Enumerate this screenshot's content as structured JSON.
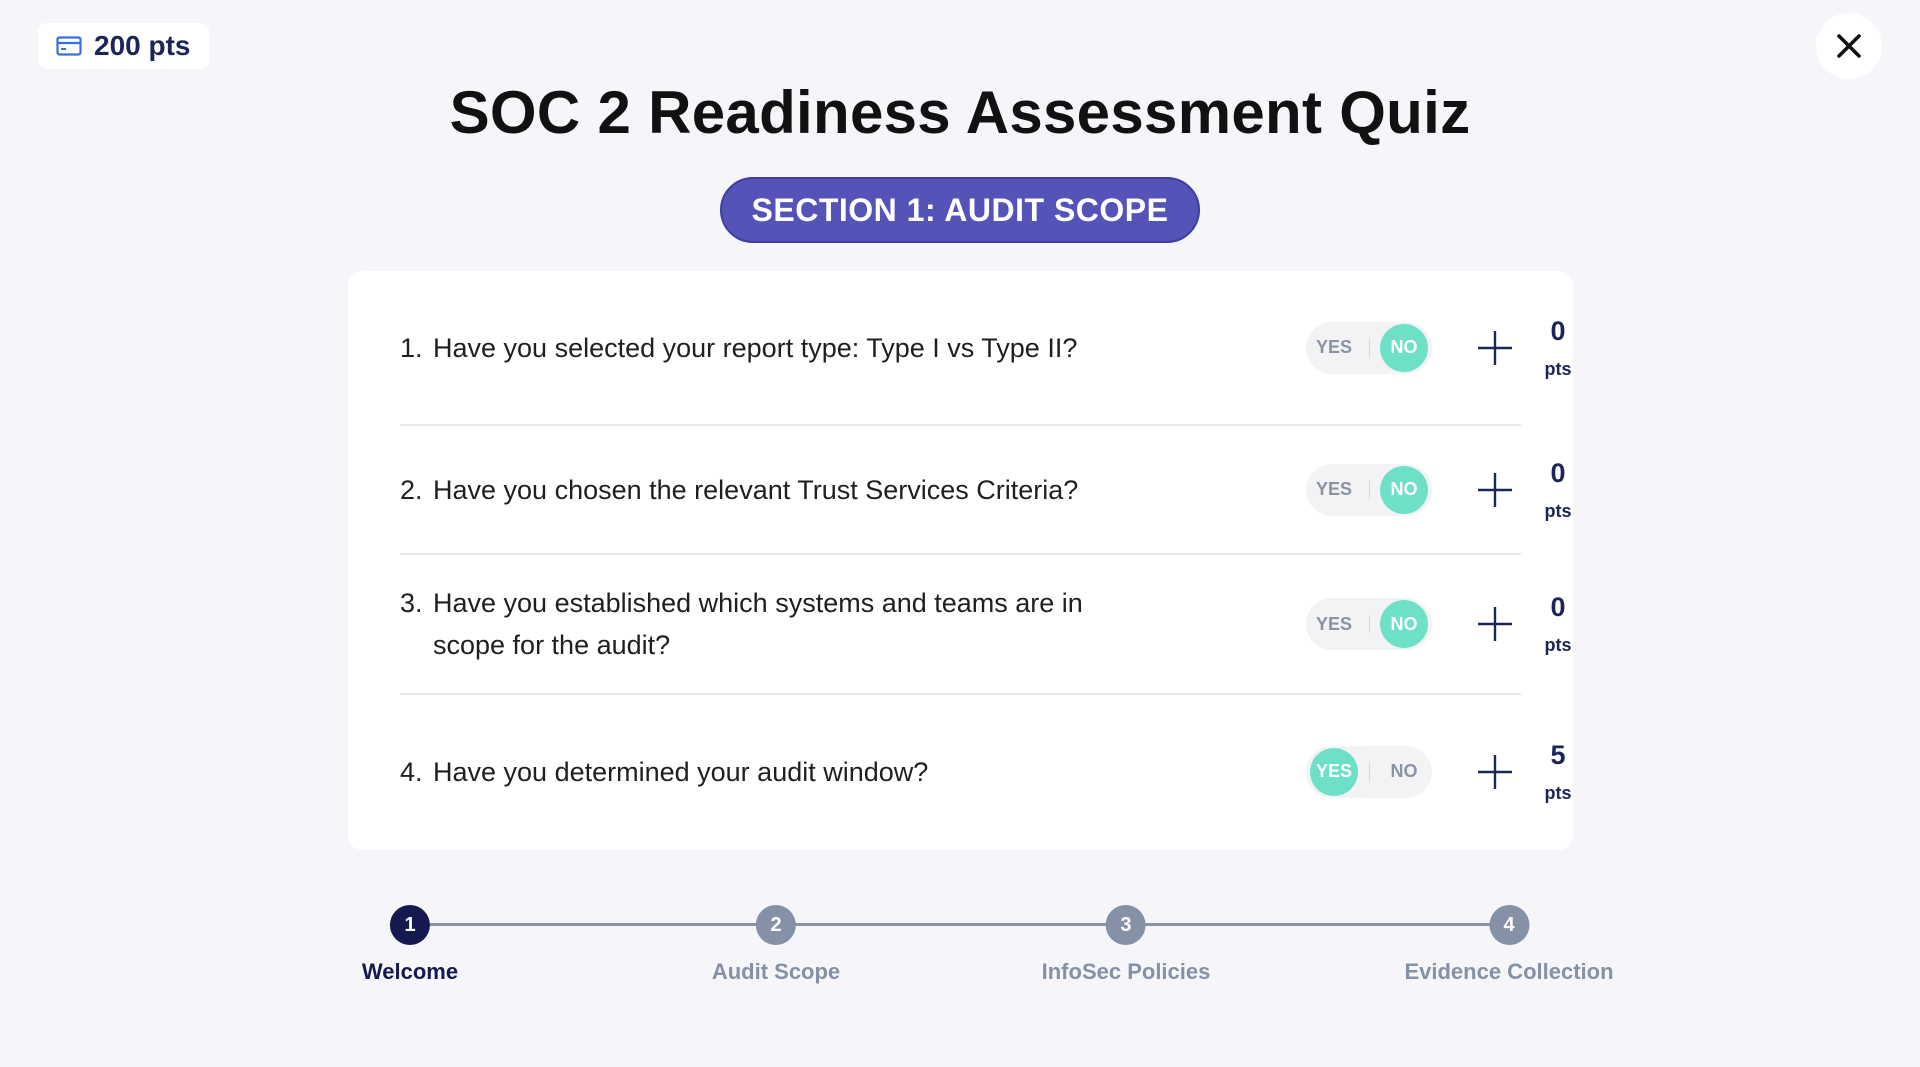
{
  "header": {
    "points_badge": "200 pts",
    "points_icon": "credit-card-icon",
    "close_icon": "close-icon"
  },
  "title": "SOC 2 Readiness Assessment Quiz",
  "section_label": "SECTION 1: AUDIT SCOPE",
  "colors": {
    "accent": "#5353b8",
    "toggle_active": "#6ee0c8",
    "navy": "#1b2559",
    "step_current": "#141a4f",
    "step_inactive": "#8591a7",
    "background": "#f5f5fa"
  },
  "questions": [
    {
      "number": "1.",
      "text": "Have you selected your report type: Type I vs Type II?",
      "yes_label": "YES",
      "no_label": "NO",
      "selected": "NO",
      "points": "0",
      "points_unit": "pts"
    },
    {
      "number": "2.",
      "text": "Have you chosen the relevant Trust Services Criteria?",
      "yes_label": "YES",
      "no_label": "NO",
      "selected": "NO",
      "points": "0",
      "points_unit": "pts"
    },
    {
      "number": "3.",
      "text": "Have you established which systems and teams are in scope for the audit?",
      "yes_label": "YES",
      "no_label": "NO",
      "selected": "NO",
      "points": "0",
      "points_unit": "pts"
    },
    {
      "number": "4.",
      "text": "Have you determined your audit window?",
      "yes_label": "YES",
      "no_label": "NO",
      "selected": "YES",
      "points": "5",
      "points_unit": "pts"
    }
  ],
  "stepper": {
    "current": 1,
    "steps": [
      {
        "number": "1",
        "label": "Welcome"
      },
      {
        "number": "2",
        "label": "Audit Scope"
      },
      {
        "number": "3",
        "label": "InfoSec Policies"
      },
      {
        "number": "4",
        "label": "Evidence Collection"
      }
    ]
  }
}
